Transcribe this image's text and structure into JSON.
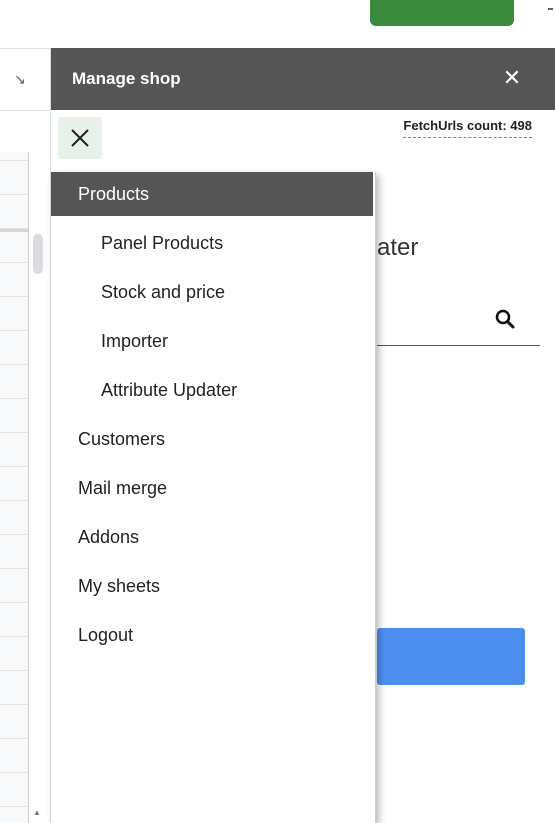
{
  "panel": {
    "title": "Manage shop",
    "close_glyph": "✕",
    "fetch_count": "FetchUrls count: 498"
  },
  "background": {
    "heading_fragment": "ater"
  },
  "menu": {
    "items": [
      {
        "label": "Products",
        "level": 1,
        "active": true
      },
      {
        "label": "Panel Products",
        "level": 2,
        "active": false
      },
      {
        "label": "Stock and price",
        "level": 2,
        "active": false
      },
      {
        "label": "Importer",
        "level": 2,
        "active": false
      },
      {
        "label": "Attribute Updater",
        "level": 2,
        "active": false
      },
      {
        "label": "Customers",
        "level": 1,
        "active": false
      },
      {
        "label": "Mail merge",
        "level": 1,
        "active": false
      },
      {
        "label": "Addons",
        "level": 1,
        "active": false
      },
      {
        "label": "My sheets",
        "level": 1,
        "active": false
      },
      {
        "label": "Logout",
        "level": 1,
        "active": false
      }
    ]
  },
  "icons": {
    "panel_close": "close-icon",
    "menu_toggle": "close-icon",
    "search": "search-icon"
  },
  "colors": {
    "header_bg": "#555555",
    "active_item_bg": "#555555",
    "toggle_bg": "#e7f1ea",
    "primary_button": "#4d8ff0",
    "top_button": "#3b8a3e",
    "fetch_underline": "#4a86e8"
  }
}
